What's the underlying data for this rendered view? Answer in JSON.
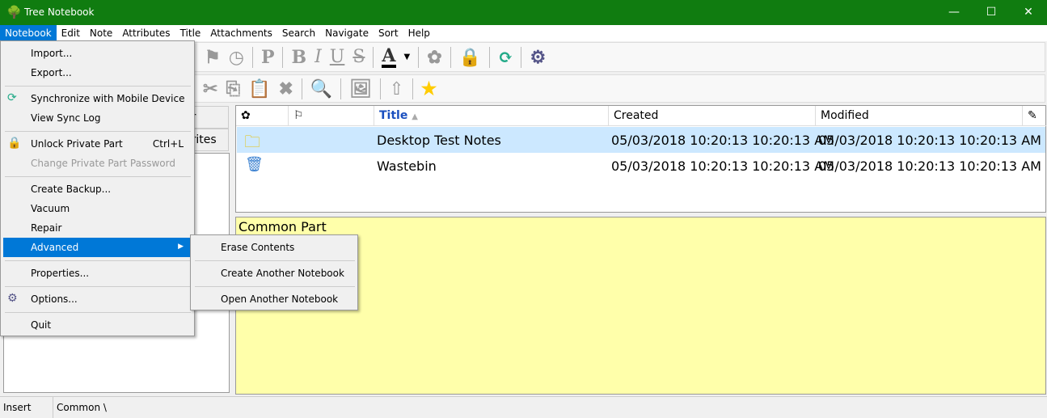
{
  "app": {
    "title": "Tree Notebook",
    "accent": "#107c10"
  },
  "menubar": [
    "Notebook",
    "Edit",
    "Note",
    "Attributes",
    "Title",
    "Attachments",
    "Search",
    "Navigate",
    "Sort",
    "Help"
  ],
  "notebook_menu": {
    "import": "Import...",
    "export": "Export...",
    "sync": "Synchronize with Mobile Device",
    "sync_log": "View Sync Log",
    "unlock": "Unlock Private Part",
    "unlock_shortcut": "Ctrl+L",
    "change_pw": "Change Private Part Password",
    "backup": "Create Backup...",
    "vacuum": "Vacuum",
    "repair": "Repair",
    "advanced": "Advanced",
    "properties": "Properties...",
    "options": "Options...",
    "quit": "Quit"
  },
  "advanced_submenu": [
    "Erase Contents",
    "Create Another Notebook",
    "Open Another Notebook"
  ],
  "toolbar1": [
    "P",
    "B",
    "I",
    "U",
    "S",
    "A"
  ],
  "left_tabs": [
    "ar",
    "orites"
  ],
  "list": {
    "columns": {
      "title": "Title",
      "created": "Created",
      "modified": "Modified"
    },
    "rows": [
      {
        "icon": "folder-icon",
        "title": "Desktop Test Notes",
        "created": "05/03/2018 10:20:13 10:20:13 AM",
        "modified": "05/03/2018 10:20:13 10:20:13 AM",
        "selected": true
      },
      {
        "icon": "wastebin-icon",
        "title": "Wastebin",
        "created": "05/03/2018 10:20:13 10:20:13 AM",
        "modified": "05/03/2018 10:20:13 10:20:13 AM",
        "selected": false
      }
    ]
  },
  "note": {
    "text": "Common Part",
    "background": "#ffffaa"
  },
  "status": {
    "mode": "Insert",
    "path": "Common \\"
  }
}
